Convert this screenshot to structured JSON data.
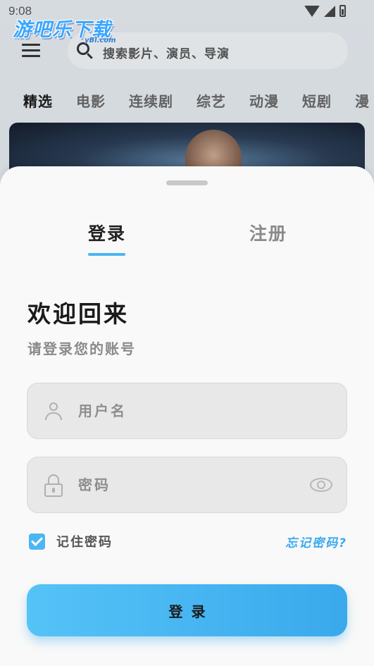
{
  "status_bar": {
    "time": "9:08"
  },
  "background": {
    "logo": "游吧乐下载",
    "logo_sub": "yBl.com",
    "search": {
      "placeholder": "搜索影片、演员、导演"
    },
    "categories": [
      "精选",
      "电影",
      "连续剧",
      "综艺",
      "动漫",
      "短剧",
      "漫"
    ],
    "active_category": "精选"
  },
  "login_sheet": {
    "tabs": {
      "login": "登录",
      "register": "注册",
      "active": "login"
    },
    "welcome_title": "欢迎回来",
    "welcome_subtitle": "请登录您的账号",
    "username": {
      "placeholder": "用户名",
      "value": ""
    },
    "password": {
      "placeholder": "密码",
      "value": ""
    },
    "remember": {
      "label": "记住密码",
      "checked": true
    },
    "forgot_link": "忘记密码?",
    "submit_label": "登录"
  },
  "colors": {
    "accent": "#4db5f2",
    "link": "#3aaaf0",
    "field_bg": "#e8e8e8"
  },
  "icons": [
    "menu-icon",
    "search-icon",
    "user-icon",
    "lock-icon",
    "eye-icon",
    "check-icon",
    "wifi-icon",
    "signal-icon",
    "battery-icon"
  ]
}
